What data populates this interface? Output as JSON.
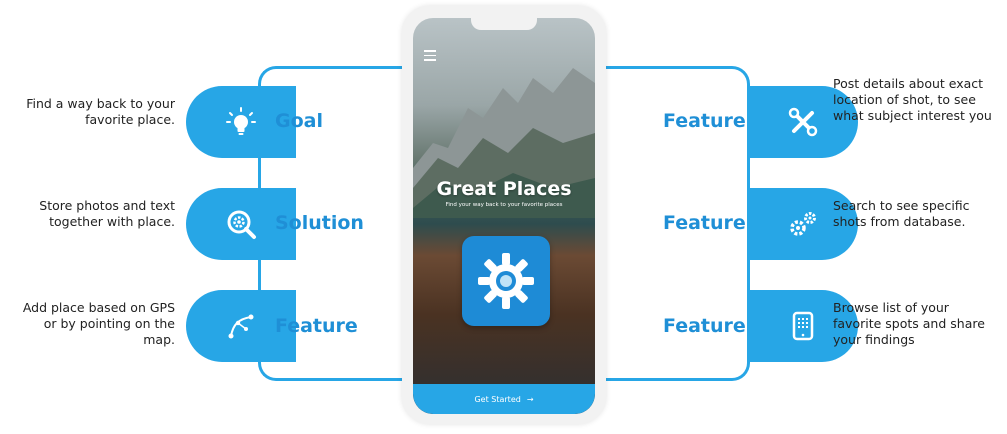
{
  "left": [
    {
      "label": "Goal",
      "description": "Find a way back to your favorite place.",
      "icon": "lightbulb-icon"
    },
    {
      "label": "Solution",
      "description": "Store photos and text together with place.",
      "icon": "search-gear-icon"
    },
    {
      "label": "Feature",
      "description": "Add place based on GPS or by pointing on the map.",
      "icon": "vector-path-icon"
    }
  ],
  "right": [
    {
      "label": "Feature",
      "description": "Post details about exact location of shot, to see what subject interest you",
      "icon": "wrench-screwdriver-icon"
    },
    {
      "label": "Feature",
      "description": "Search to see specific shots from database.",
      "icon": "gears-icon"
    },
    {
      "label": "Feature",
      "description": "Browse list of your favorite spots and share your findings",
      "icon": "tablet-icon"
    }
  ],
  "phone": {
    "title": "Great Places",
    "subtitle": "Find your way back to your favorite places",
    "button_label": "Get Started",
    "button_arrow": "→"
  },
  "colors": {
    "accent": "#27a6e6",
    "label": "#1f8fd6"
  }
}
